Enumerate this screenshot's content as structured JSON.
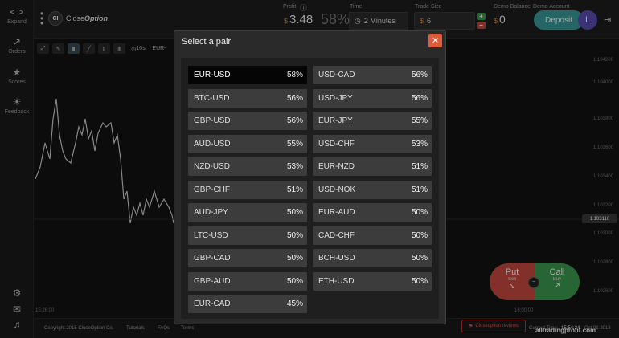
{
  "sidebar": {
    "items": [
      {
        "label": "Expand",
        "icon": "expand-icon"
      },
      {
        "label": "Orders",
        "icon": "chart-icon"
      },
      {
        "label": "Scores",
        "icon": "trophy-icon"
      },
      {
        "label": "Feedback",
        "icon": "lightbulb-icon"
      }
    ]
  },
  "header": {
    "brand_prefix": "Close",
    "brand_suffix": "Option",
    "logo_badge": "CI",
    "profit_label": "Profit",
    "profit_currency": "$",
    "profit_value": "3.48",
    "profit_percent": "58%",
    "time_label": "Time",
    "time_value": "2 Minutes",
    "trade_size_label": "Trade Size",
    "trade_size_currency": "$",
    "trade_size_value": "6",
    "demo_balance_label": "Demo Balance",
    "demo_balance_currency": "$",
    "demo_balance_value": "0",
    "demo_account_label": "Demo Account",
    "deposit_label": "Deposit",
    "avatar_letter": "L"
  },
  "chart": {
    "symbol_partial": "EUR-",
    "price_ticks": [
      "1.104200",
      "1.104000",
      "1.103800",
      "1.103600",
      "1.103400",
      "1.103200",
      "1.103000",
      "1.102800",
      "1.102600"
    ],
    "current_price": "1.103110",
    "time_left": "15:26:00",
    "time_right": "16:00:00",
    "zoom_label": "10s"
  },
  "trade": {
    "put_label": "Put",
    "put_sub": "Sell",
    "call_label": "Call",
    "call_sub": "Buy"
  },
  "footer": {
    "copyright": "Copyright 2015 CloseOption Co.",
    "tutorials": "Tutorials",
    "faqs": "FAQs",
    "terms": "Terms",
    "reviews": "Closeoption reviews",
    "current_time_label": "Current Time:",
    "current_time": "15:54:24",
    "current_date": "Oct 01 2018",
    "watermark": "alltradingprofit.com"
  },
  "modal": {
    "title": "Select a pair",
    "pairs": [
      {
        "name": "EUR-USD",
        "pct": "58%",
        "active": true
      },
      {
        "name": "USD-CAD",
        "pct": "56%"
      },
      {
        "name": "BTC-USD",
        "pct": "56%"
      },
      {
        "name": "USD-JPY",
        "pct": "56%"
      },
      {
        "name": "GBP-USD",
        "pct": "56%"
      },
      {
        "name": "EUR-JPY",
        "pct": "55%"
      },
      {
        "name": "AUD-USD",
        "pct": "55%"
      },
      {
        "name": "USD-CHF",
        "pct": "53%"
      },
      {
        "name": "NZD-USD",
        "pct": "53%"
      },
      {
        "name": "EUR-NZD",
        "pct": "51%"
      },
      {
        "name": "GBP-CHF",
        "pct": "51%"
      },
      {
        "name": "USD-NOK",
        "pct": "51%"
      },
      {
        "name": "AUD-JPY",
        "pct": "50%"
      },
      {
        "name": "EUR-AUD",
        "pct": "50%"
      },
      {
        "name": "LTC-USD",
        "pct": "50%"
      },
      {
        "name": "CAD-CHF",
        "pct": "50%"
      },
      {
        "name": "GBP-CAD",
        "pct": "50%"
      },
      {
        "name": "BCH-USD",
        "pct": "50%"
      },
      {
        "name": "GBP-AUD",
        "pct": "50%"
      },
      {
        "name": "ETH-USD",
        "pct": "50%"
      },
      {
        "name": "EUR-CAD",
        "pct": "45%"
      }
    ]
  }
}
